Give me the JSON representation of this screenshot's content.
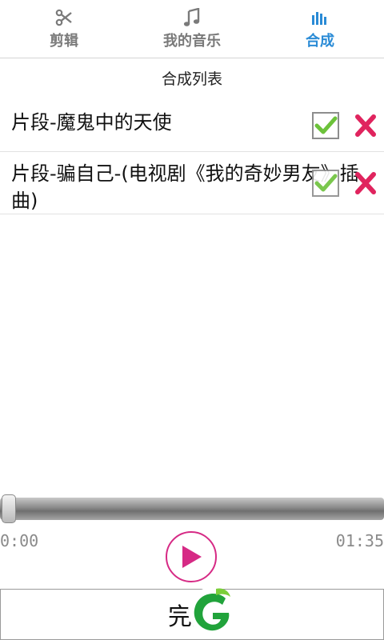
{
  "tabs": [
    {
      "label": "剪辑",
      "icon": "scissors-icon",
      "active": false
    },
    {
      "label": "我的音乐",
      "icon": "music-note-icon",
      "active": false
    },
    {
      "label": "合成",
      "icon": "equalizer-icon",
      "active": true
    }
  ],
  "colors": {
    "accent": "#2a8bd6",
    "play": "#d62a85",
    "delete": "#e0245e",
    "check": "#6cc23a"
  },
  "list": {
    "title": "合成列表",
    "items": [
      {
        "name": "片段-魔鬼中的天使",
        "checked": true
      },
      {
        "name": "片段-骗自己-(电视剧《我的奇妙男友》插曲)",
        "checked": true
      }
    ]
  },
  "player": {
    "current_time": "0:00",
    "total_time": "01:35",
    "progress": 0
  },
  "done_button": {
    "label": "完成"
  }
}
